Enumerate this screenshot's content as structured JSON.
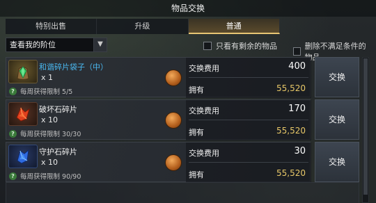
{
  "window": {
    "title": "物品交换"
  },
  "tabs": [
    {
      "label": "特别出售"
    },
    {
      "label": "升级"
    },
    {
      "label": "普通"
    },
    {
      "label": ""
    }
  ],
  "filters": {
    "rank_select": "查看我的阶位",
    "only_remaining": "只看有剩余的物品",
    "remove_unmet": "删除不满足条件的物品"
  },
  "cost_label": "交换费用",
  "own_label": "拥有",
  "exchange_label": "交换",
  "items": [
    {
      "name": "和谐碎片袋子（中）",
      "qty": "x 1",
      "limit": "每周获得限制 5/5",
      "cost": "400",
      "owned": "55,520"
    },
    {
      "name": "破坏石碎片",
      "qty": "x 10",
      "limit": "每周获得限制 30/30",
      "cost": "170",
      "owned": "55,520"
    },
    {
      "name": "守护石碎片",
      "qty": "x 10",
      "limit": "每周获得限制 90/90",
      "cost": "30",
      "owned": "55,520"
    }
  ],
  "icons": {
    "item1": "green-gem-pouch-icon",
    "item2": "red-crystal-shard-icon",
    "item3": "blue-crystal-shard-icon",
    "currency": "orange-coin-icon",
    "help": "question-mark-icon",
    "dropdown": "chevron-down-icon"
  },
  "colors": {
    "accent_gold": "#e8c574",
    "owned_gold": "#e8c868",
    "item_name_cyan": "#4ab8f0"
  }
}
